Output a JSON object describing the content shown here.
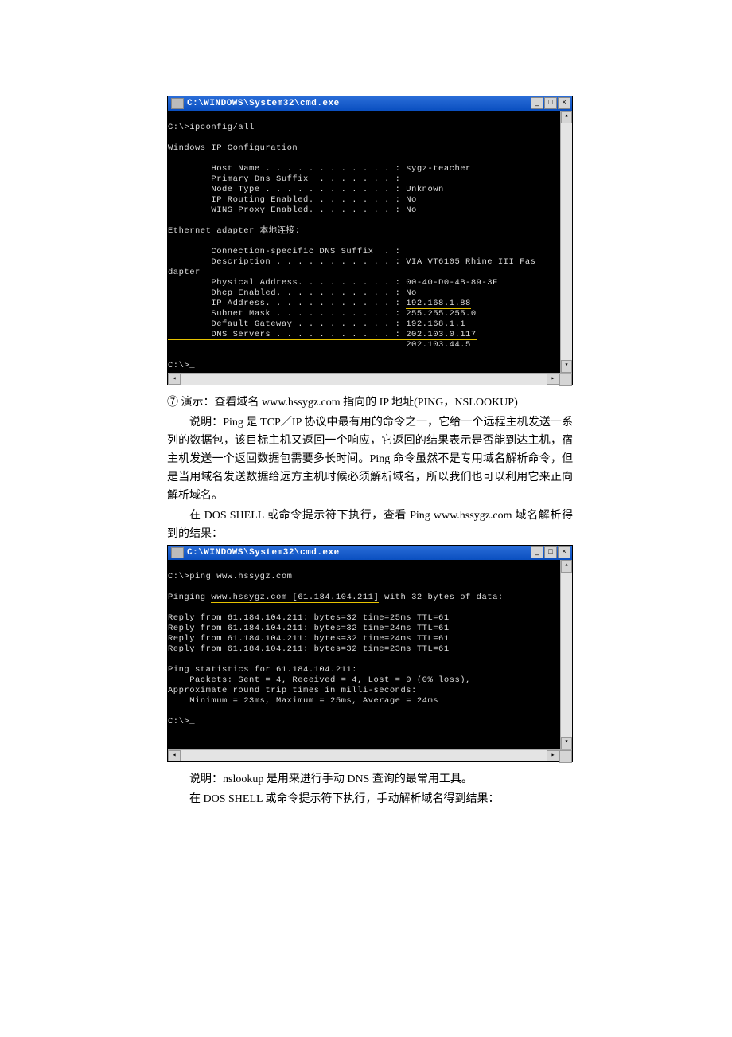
{
  "cmd_title": "C:\\WINDOWS\\System32\\cmd.exe",
  "win1": {
    "prompt": "C:\\>ipconfig/all",
    "heading": "Windows IP Configuration",
    "host_name": "        Host Name . . . . . . . . . . . . : sygz-teacher",
    "dns_suffix": "        Primary Dns Suffix  . . . . . . . :",
    "node_type": "        Node Type . . . . . . . . . . . . : Unknown",
    "ip_routing": "        IP Routing Enabled. . . . . . . . : No",
    "wins_proxy": "        WINS Proxy Enabled. . . . . . . . : No",
    "adapter": "Ethernet adapter 本地连接:",
    "conn_suffix": "        Connection-specific DNS Suffix  . :",
    "description": "        Description . . . . . . . . . . . : VIA VT6105 Rhine III Fas",
    "dapter": "dapter",
    "phys_addr": "        Physical Address. . . . . . . . . : 00-40-D0-4B-89-3F",
    "dhcp": "        Dhcp Enabled. . . . . . . . . . . : No",
    "ip_label": "        IP Address. . . . . . . . . . . . : ",
    "ip_value": "192.168.1.88",
    "subnet": "        Subnet Mask . . . . . . . . . . . : 255.255.255.0",
    "gateway": "        Default Gateway . . . . . . . . . : 192.168.1.1",
    "dns_label": "        DNS Servers . . . . . . . . . . . : ",
    "dns1": "202.103.0.117",
    "dns2_pad": "                                            ",
    "dns2": "202.103.44.5",
    "prompt_end": "C:\\>_"
  },
  "para1": "⑦ 演示：查看域名 www.hssygz.com 指向的 IP 地址(PING，NSLOOKUP)",
  "para2": "说明：Ping 是 TCP／IP 协议中最有用的命令之一，它给一个远程主机发送一系列的数据包，该目标主机又返回一个响应，它返回的结果表示是否能到达主机，宿主机发送一个返回数据包需要多长时间。Ping 命令虽然不是专用域名解析命令，但是当用域名发送数据给远方主机时候必须解析域名，所以我们也可以利用它来正向解析域名。",
  "para3": "在 DOS SHELL 或命令提示符下执行，查看 Ping www.hssygz.com 域名解析得到的结果：",
  "win2": {
    "prompt": "C:\\>ping www.hssygz.com",
    "pinging_pre": "Pinging ",
    "pinging_host": "www.hssygz.com [61.184.104.211]",
    "pinging_post": " with 32 bytes of data:",
    "reply1": "Reply from 61.184.104.211: bytes=32 time=25ms TTL=61",
    "reply2": "Reply from 61.184.104.211: bytes=32 time=24ms TTL=61",
    "reply3": "Reply from 61.184.104.211: bytes=32 time=24ms TTL=61",
    "reply4": "Reply from 61.184.104.211: bytes=32 time=23ms TTL=61",
    "stats1": "Ping statistics for 61.184.104.211:",
    "stats2": "    Packets: Sent = 4, Received = 4, Lost = 0 (0% loss),",
    "stats3": "Approximate round trip times in milli-seconds:",
    "stats4": "    Minimum = 23ms, Maximum = 25ms, Average = 24ms",
    "prompt_end": "C:\\>_"
  },
  "para4": "说明：nslookup 是用来进行手动 DNS 查询的最常用工具。",
  "para5": "在 DOS SHELL 或命令提示符下执行，手动解析域名得到结果："
}
